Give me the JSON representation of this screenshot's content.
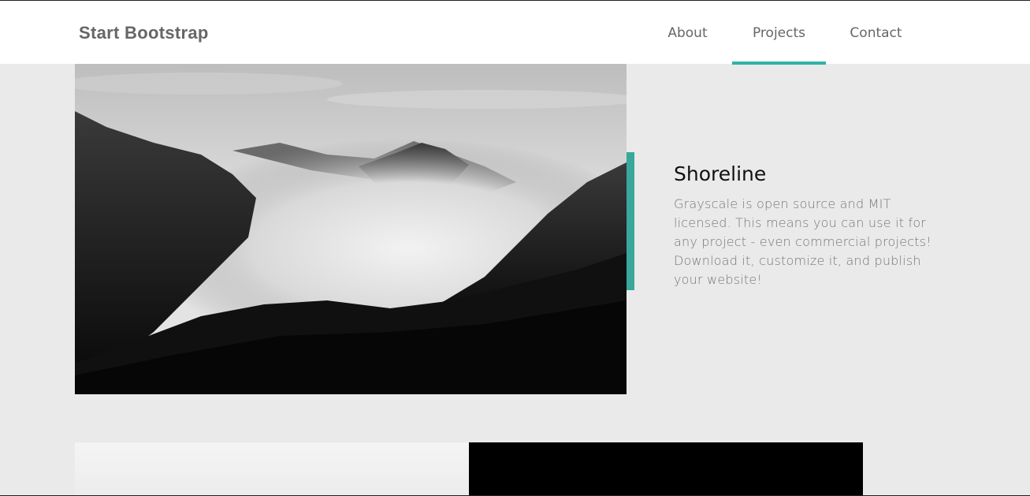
{
  "navbar": {
    "brand": "Start Bootstrap",
    "items": [
      {
        "label": "About",
        "active": false
      },
      {
        "label": "Projects",
        "active": true
      },
      {
        "label": "Contact",
        "active": false
      }
    ],
    "accent_color": "#2fb3a7"
  },
  "project": {
    "title": "Shoreline",
    "description": "Grayscale is open source and MIT licensed. This means you can use it for any project - even commercial projects! Download it, customize it, and publish your website!",
    "image": "misty-mountain-forest-grayscale-photo"
  },
  "colors": {
    "page_background": "#eaeaea",
    "accent": "#3aa79b"
  }
}
